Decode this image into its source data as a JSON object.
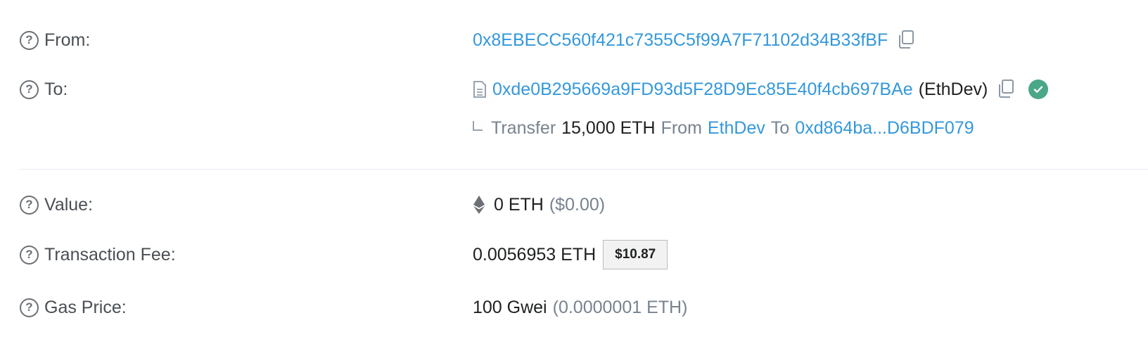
{
  "from": {
    "label": "From:",
    "address": "0x8EBECC560f421c7355C5f99A7F71102d34B33fBF"
  },
  "to": {
    "label": "To:",
    "address": "0xde0B295669a9FD93d5F28D9Ec85E40f4cb697BAe",
    "name_tag": "(EthDev)"
  },
  "transfer": {
    "word_transfer": "Transfer",
    "amount": "15,000 ETH",
    "word_from": "From",
    "from_name": "EthDev",
    "word_to": "To",
    "to_address": "0xd864ba...D6BDF079"
  },
  "value": {
    "label": "Value:",
    "amount": "0 ETH",
    "usd": "($0.00)"
  },
  "fee": {
    "label": "Transaction Fee:",
    "amount": "0.0056953 ETH",
    "usd_badge": "$10.87"
  },
  "gas": {
    "label": "Gas Price:",
    "amount": "100 Gwei",
    "eth": "(0.0000001 ETH)"
  },
  "icons": {
    "help": "help-icon",
    "copy": "copy-icon",
    "verified": "check-circle-icon",
    "contract": "document-icon",
    "ether": "ethereum-icon"
  },
  "colors": {
    "link": "#3498db",
    "muted": "#77838f",
    "verified": "#4aa787"
  }
}
